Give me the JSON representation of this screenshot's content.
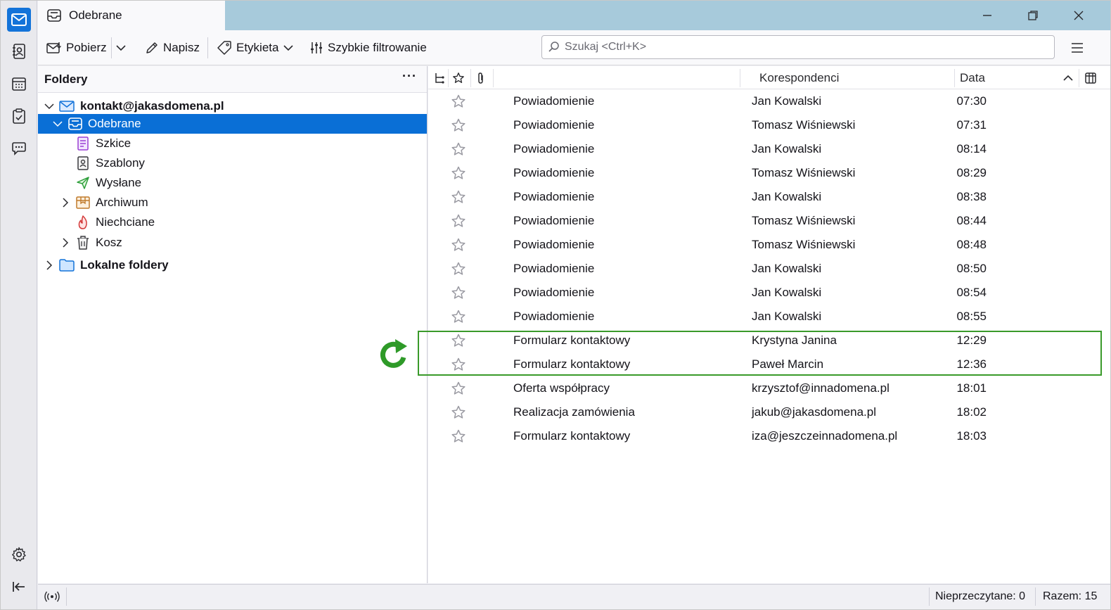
{
  "window": {
    "tab_title": "Odebrane",
    "minimize_icon": "minimize-icon",
    "maximize_icon": "restore-icon",
    "close_icon": "close-icon"
  },
  "spaces": [
    {
      "name": "mail",
      "icon": "mail-icon",
      "active": true
    },
    {
      "name": "address-book",
      "icon": "address-book-icon",
      "active": false
    },
    {
      "name": "calendar",
      "icon": "calendar-icon",
      "active": false
    },
    {
      "name": "tasks",
      "icon": "tasks-icon",
      "active": false
    },
    {
      "name": "chat",
      "icon": "chat-icon",
      "active": false
    }
  ],
  "toolbar": {
    "get_messages": "Pobierz",
    "write": "Napisz",
    "tag": "Etykieta",
    "quick_filter": "Szybkie filtrowanie",
    "search_placeholder": "Szukaj <Ctrl+K>"
  },
  "folder_pane": {
    "header": "Foldery",
    "menu": "···",
    "account": "kontakt@jakasdomena.pl",
    "folders": [
      {
        "label": "Odebrane",
        "icon": "inbox-icon"
      },
      {
        "label": "Szkice",
        "icon": "drafts-icon"
      },
      {
        "label": "Szablony",
        "icon": "templates-icon"
      },
      {
        "label": "Wysłane",
        "icon": "sent-icon"
      },
      {
        "label": "Archiwum",
        "icon": "archive-icon"
      },
      {
        "label": "Niechciane",
        "icon": "junk-icon"
      },
      {
        "label": "Kosz",
        "icon": "trash-icon"
      }
    ],
    "local_folders": "Lokalne foldery"
  },
  "message_list": {
    "columns": {
      "correspondents": "Korespondenci",
      "date": "Data"
    },
    "rows": [
      {
        "subject": "Powiadomienie",
        "from": "Jan Kowalski",
        "date": "07:30"
      },
      {
        "subject": "Powiadomienie",
        "from": "Tomasz Wiśniewski",
        "date": "07:31"
      },
      {
        "subject": "Powiadomienie",
        "from": "Jan Kowalski",
        "date": "08:14"
      },
      {
        "subject": "Powiadomienie",
        "from": "Tomasz Wiśniewski",
        "date": "08:29"
      },
      {
        "subject": "Powiadomienie",
        "from": "Jan Kowalski",
        "date": "08:38"
      },
      {
        "subject": "Powiadomienie",
        "from": "Tomasz Wiśniewski",
        "date": "08:44"
      },
      {
        "subject": "Powiadomienie",
        "from": "Tomasz Wiśniewski",
        "date": "08:48"
      },
      {
        "subject": "Powiadomienie",
        "from": "Jan Kowalski",
        "date": "08:50"
      },
      {
        "subject": "Powiadomienie",
        "from": "Jan Kowalski",
        "date": "08:54"
      },
      {
        "subject": "Powiadomienie",
        "from": "Jan Kowalski",
        "date": "08:55"
      },
      {
        "subject": "Formularz kontaktowy",
        "from": "Krystyna Janina",
        "date": "12:29"
      },
      {
        "subject": "Formularz kontaktowy",
        "from": "Paweł Marcin",
        "date": "12:36"
      },
      {
        "subject": "Oferta współpracy",
        "from": "krzysztof@innadomena.pl",
        "date": "18:01"
      },
      {
        "subject": "Realizacja zamówienia",
        "from": "jakub@jakasdomena.pl",
        "date": "18:02"
      },
      {
        "subject": "Formularz kontaktowy",
        "from": "iza@jeszczeinnadomena.pl",
        "date": "18:03"
      }
    ]
  },
  "statusbar": {
    "unread": "Nieprzeczytane: 0",
    "total": "Razem: 15"
  },
  "colors": {
    "accent": "#0a6fd6",
    "highlight": "#3a9a2a",
    "titlebar": "#a7cadb"
  }
}
